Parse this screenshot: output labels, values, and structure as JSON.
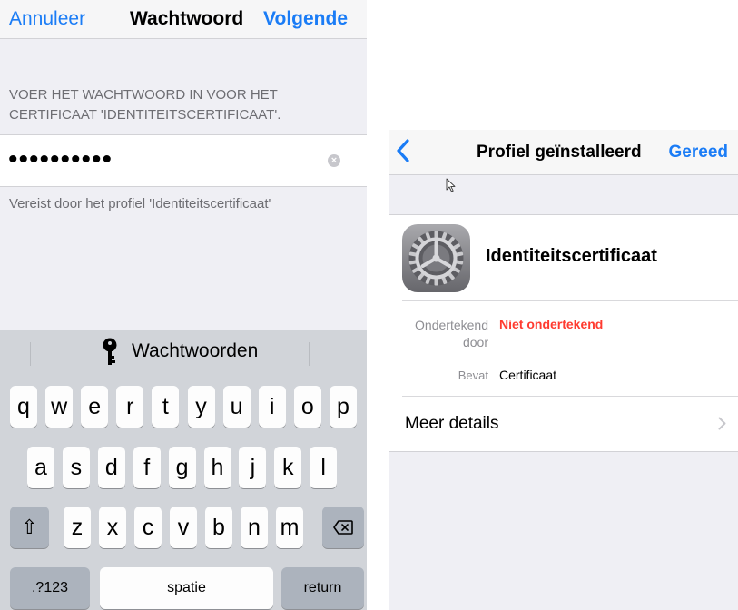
{
  "left": {
    "nav": {
      "cancel": "Annuleer",
      "title": "Wachtwoord",
      "next": "Volgende"
    },
    "instruction": "VOER HET WACHTWOORD IN VOOR HET CERTIFICAAT 'IDENTITEITSCERTIFICAAT'.",
    "password_value": "••••••••••",
    "footer": "Vereist door het profiel 'Identiteitscertificaat'",
    "keyboard": {
      "suggestion": "Wachtwoorden",
      "row1": [
        "q",
        "w",
        "e",
        "r",
        "t",
        "y",
        "u",
        "i",
        "o",
        "p"
      ],
      "row2": [
        "a",
        "s",
        "d",
        "f",
        "g",
        "h",
        "j",
        "k",
        "l"
      ],
      "row3": [
        "z",
        "x",
        "c",
        "v",
        "b",
        "n",
        "m"
      ],
      "shift_glyph": "⇧",
      "numbers": ".?123",
      "space": "spatie",
      "return": "return"
    }
  },
  "right": {
    "nav": {
      "title": "Profiel geïnstalleerd",
      "done": "Gereed"
    },
    "profile_name": "Identiteitscertificaat",
    "signed_label": "Ondertekend door",
    "signed_value": "Niet ondertekend",
    "contains_label": "Bevat",
    "contains_value": "Certificaat",
    "more_details": "Meer details"
  },
  "colors": {
    "accent": "#1a7cf6",
    "warning": "#ff3b30",
    "background": "#efeff4",
    "keyboard": "#d1d4d9"
  }
}
